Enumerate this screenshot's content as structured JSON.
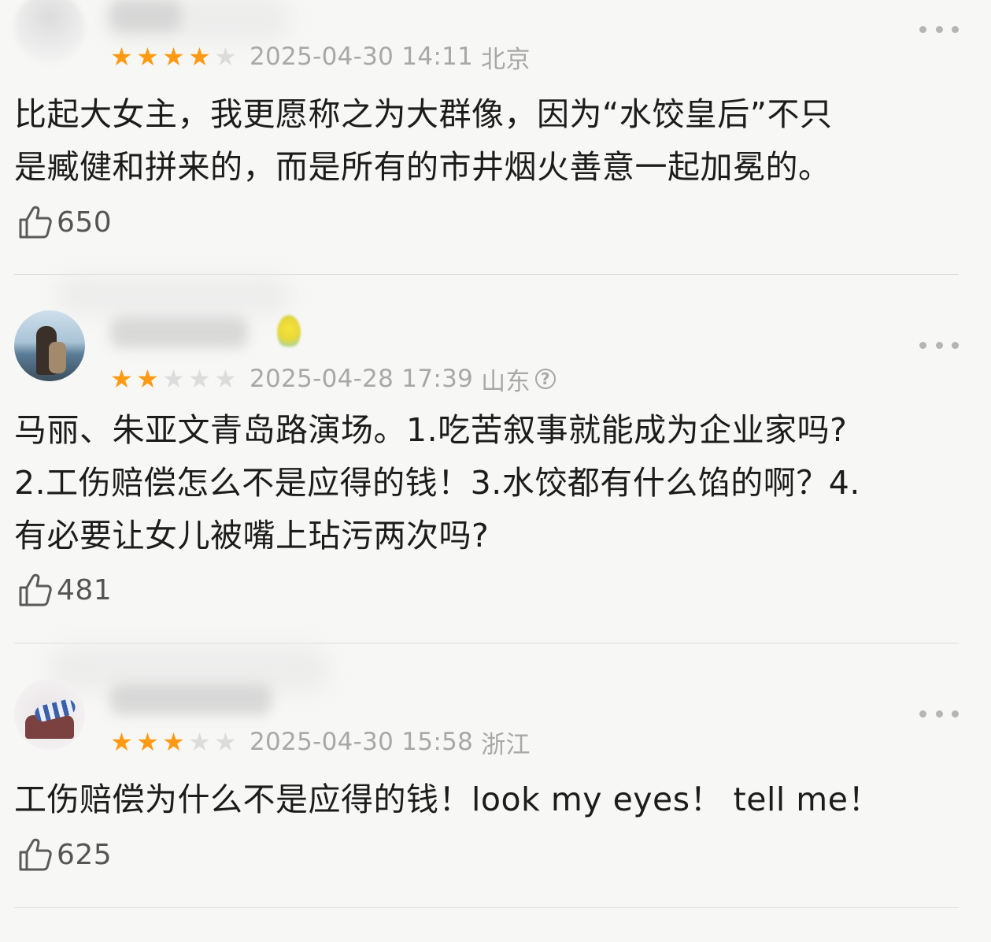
{
  "comments": [
    {
      "stars": 4,
      "date": "2025-04-30 14:11",
      "location": "北京",
      "has_help_icon": false,
      "text": "比起大女主，我更愿称之为大群像，因为“水饺皇后”不只\n是臧健和拼来的，而是所有的市井烟火善意一起加冕的。",
      "likes": "650"
    },
    {
      "stars": 2,
      "date": "2025-04-28 17:39",
      "location": "山东",
      "has_help_icon": true,
      "text": "马丽、朱亚文青岛路演场。1.吃苦叙事就能成为企业家吗?\n2.工伤赔偿怎么不是应得的钱！3.水饺都有什么馅的啊？4.\n有必要让女儿被嘴上玷污两次吗?",
      "likes": "481"
    },
    {
      "stars": 3,
      "date": "2025-04-30 15:58",
      "location": "浙江",
      "has_help_icon": false,
      "text": "工伤赔偿为什么不是应得的钱！look my eyes！ tell me！",
      "likes": "625"
    }
  ],
  "colors": {
    "star_on": "#ff9a12",
    "star_off": "#dcdcdc",
    "meta": "#a8a8a8",
    "text": "#1c1c1c",
    "background": "#f7f7f5"
  },
  "icons": {
    "like": "thumbs-up-icon",
    "more": "more-dots-icon",
    "help": "help-circle-icon"
  }
}
